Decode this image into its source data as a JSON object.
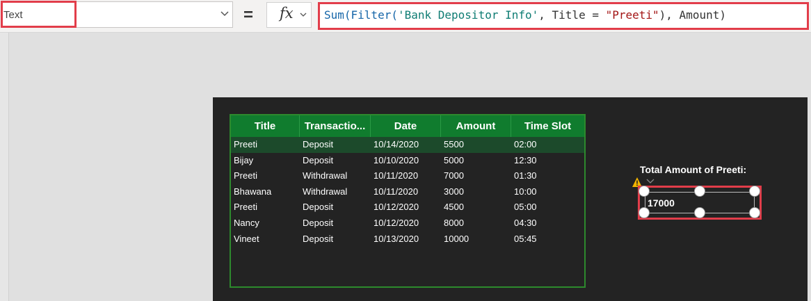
{
  "formula_bar": {
    "property": "Text",
    "equals": "=",
    "fx_label": "fx",
    "formula": {
      "fn_sum": "Sum(",
      "fn_filter": "Filter(",
      "source": "'Bank Depositor Info'",
      "mid": ", Title = ",
      "string": "\"Preeti\"",
      "end": "), Amount)"
    }
  },
  "gallery": {
    "columns": [
      "Title",
      "Transactio...",
      "Date",
      "Amount",
      "Time Slot"
    ],
    "rows": [
      [
        "Preeti",
        "Deposit",
        "10/14/2020",
        "5500",
        "02:00"
      ],
      [
        "Bijay",
        "Deposit",
        "10/10/2020",
        "5000",
        "12:30"
      ],
      [
        "Preeti",
        "Withdrawal",
        "10/11/2020",
        "7000",
        "01:30"
      ],
      [
        "Bhawana",
        "Withdrawal",
        "10/11/2020",
        "3000",
        "10:00"
      ],
      [
        "Preeti",
        "Deposit",
        "10/12/2020",
        "4500",
        "05:00"
      ],
      [
        "Nancy",
        "Deposit",
        "10/12/2020",
        "8000",
        "04:30"
      ],
      [
        "Vineet",
        "Deposit",
        "10/13/2020",
        "10000",
        "05:45"
      ]
    ],
    "selected_row": 0
  },
  "total": {
    "label": "Total Amount of Preeti:",
    "value": "17000"
  },
  "colors": {
    "highlight": "#e23d4a",
    "header_green": "#107c2e",
    "screen_bg": "#232323"
  }
}
